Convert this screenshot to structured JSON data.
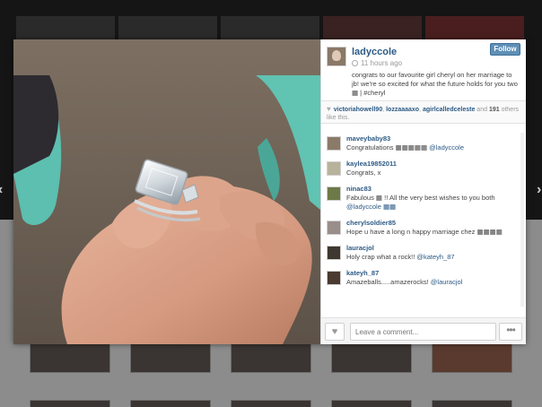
{
  "post": {
    "username": "ladyccole",
    "time": "11 hours ago",
    "caption": "congrats to our favourite girl cheryl on her marriage to jb! we're so excited for what the future holds for you two ▦ | #cheryl",
    "follow_label": "Follow"
  },
  "likes": {
    "users_1": "victoriahowell90",
    "users_2": "lozzaaaaxo",
    "users_3": "agirlcalledceleste",
    "and": "and",
    "count": "191",
    "rest": "others like this."
  },
  "comments": [
    {
      "user": "maveybaby83",
      "text": "Congratulations ▦▦▦▦▦ ",
      "mention": "@ladyccole"
    },
    {
      "user": "kaylea19852011",
      "text": "Congrats, x",
      "mention": ""
    },
    {
      "user": "ninac83",
      "text": "Fabulous ▦ !! All the very best wishes to you both ",
      "mention": "@ladyccole ▦▦"
    },
    {
      "user": "cherylsoldier85",
      "text": "Hope u have a long n happy marriage chez ▦▦▦▦",
      "mention": ""
    },
    {
      "user": "lauracjol",
      "text": "Holy crap what a rock!! ",
      "mention": "@kateyh_87"
    },
    {
      "user": "kateyh_87",
      "text": "Amazeballs.....amazerocks! ",
      "mention": "@lauracjol"
    }
  ],
  "input": {
    "placeholder": "Leave a comment..."
  },
  "icons": {
    "like": "heart-icon",
    "more": "more-icon",
    "nav_left": "chevron-left-icon",
    "nav_right": "chevron-right-icon"
  },
  "colors": {
    "link": "#2c5a85",
    "follow": "#5f8fb6"
  }
}
